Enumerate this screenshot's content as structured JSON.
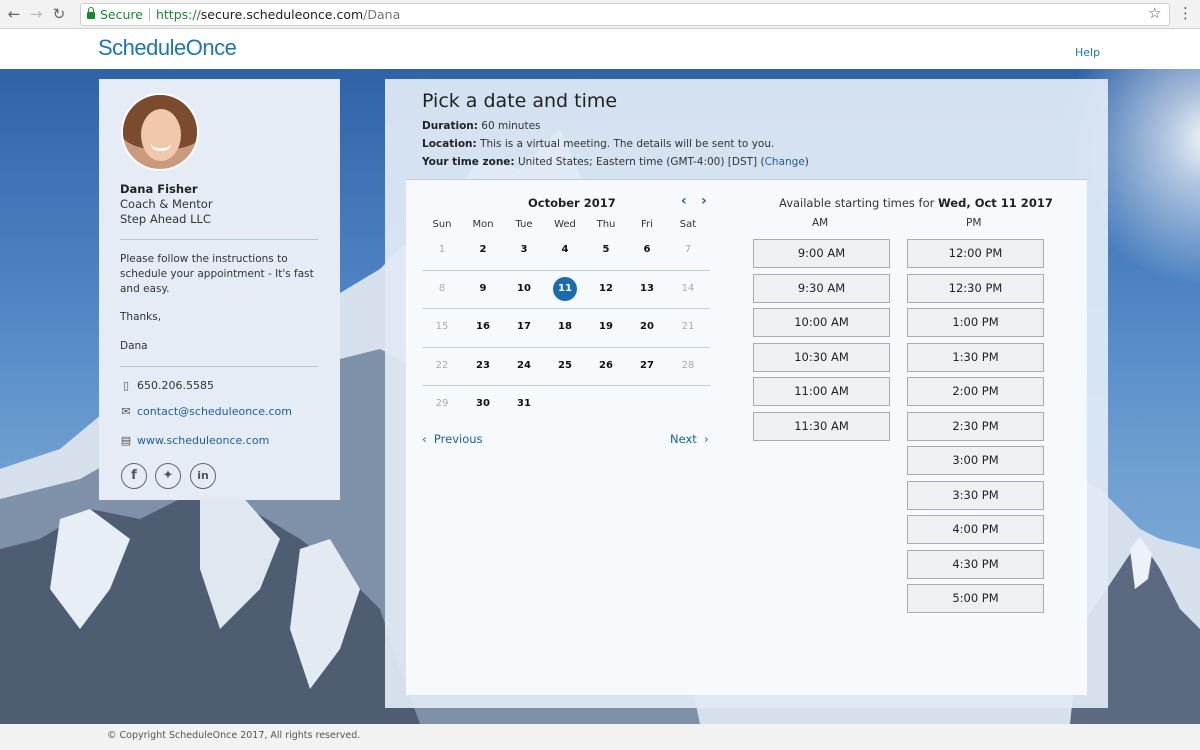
{
  "browser": {
    "secure_label": "Secure",
    "url_proto": "https://",
    "url_host": "secure.scheduleonce.com",
    "url_path": "/Dana"
  },
  "header": {
    "logo": "ScheduleOnce",
    "help": "Help"
  },
  "profile": {
    "name": "Dana Fisher",
    "title": "Coach & Mentor",
    "company": "Step Ahead LLC",
    "message": "Please follow the instructions to schedule your appointment - It's fast and easy.",
    "thanks": "Thanks,",
    "signature": "Dana",
    "phone": "650.206.5585",
    "email": "contact@scheduleonce.com",
    "website": "www.scheduleonce.com",
    "social": [
      "facebook-icon",
      "twitter-icon",
      "linkedin-icon"
    ]
  },
  "booking": {
    "title": "Pick a date and time",
    "duration_label": "Duration:",
    "duration_value": " 60 minutes",
    "location_label": "Location:",
    "location_value": " This is a virtual meeting. The details will be sent to you.",
    "timezone_label": "Your time zone:",
    "timezone_value": " United States;  Eastern time  (GMT-4:00) [DST]  (",
    "timezone_change": "Change",
    "timezone_close": ")"
  },
  "calendar": {
    "month": "October 2017",
    "weekdays": [
      "Sun",
      "Mon",
      "Tue",
      "Wed",
      "Thu",
      "Fri",
      "Sat"
    ],
    "weeks": [
      [
        "1",
        "2",
        "3",
        "4",
        "5",
        "6",
        "7"
      ],
      [
        "8",
        "9",
        "10",
        "11",
        "12",
        "13",
        "14"
      ],
      [
        "15",
        "16",
        "17",
        "18",
        "19",
        "20",
        "21"
      ],
      [
        "22",
        "23",
        "24",
        "25",
        "26",
        "27",
        "28"
      ],
      [
        "29",
        "30",
        "31",
        "",
        "",
        "",
        ""
      ]
    ],
    "selected": "11",
    "previous": "Previous",
    "next": "Next"
  },
  "times": {
    "heading_prefix": "Available starting times for ",
    "heading_date": "Wed, Oct 11 2017",
    "am_label": "AM",
    "pm_label": "PM",
    "am": [
      "9:00 AM",
      "9:30 AM",
      "10:00 AM",
      "10:30 AM",
      "11:00 AM",
      "11:30 AM"
    ],
    "pm": [
      "12:00 PM",
      "12:30 PM",
      "1:00 PM",
      "1:30 PM",
      "2:00 PM",
      "2:30 PM",
      "3:00 PM",
      "3:30 PM",
      "4:00 PM",
      "4:30 PM",
      "5:00 PM"
    ]
  },
  "footer": {
    "copyright": "© Copyright ScheduleOnce 2017, All rights reserved."
  }
}
